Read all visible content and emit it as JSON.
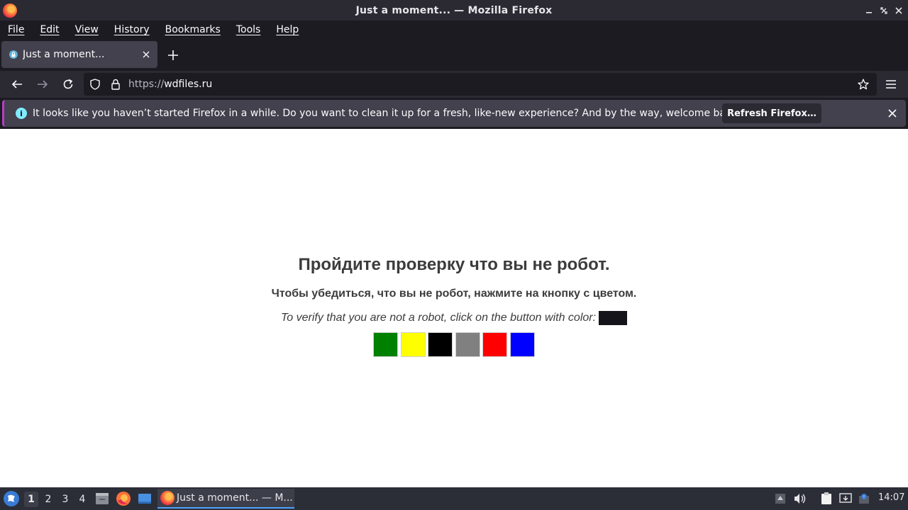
{
  "window": {
    "title": "Just a moment... — Mozilla Firefox",
    "controls": [
      "minimize-icon",
      "restore-icon",
      "close-icon"
    ]
  },
  "menubar": {
    "items": [
      {
        "label": "File"
      },
      {
        "label": "Edit"
      },
      {
        "label": "View"
      },
      {
        "label": "History"
      },
      {
        "label": "Bookmarks"
      },
      {
        "label": "Tools"
      },
      {
        "label": "Help"
      }
    ]
  },
  "tabs": [
    {
      "title": "Just a moment...",
      "active": true
    }
  ],
  "urlbar": {
    "scheme": "https://",
    "host": "wdfiles.ru"
  },
  "notification": {
    "text": "It looks like you haven’t started Firefox in a while. Do you want to clean it up for a fresh, like-new experience? And by the way, welcome back!",
    "button_label": "Refresh Firefox…"
  },
  "page": {
    "heading": "Пройдите проверку что вы не робот.",
    "subheading": "Чтобы убедиться, что вы не робот, нажмите на кнопку с цветом.",
    "instruction": "To verify that you are not a robot, click on the button with color:",
    "target_color": "#15141a",
    "color_buttons": [
      {
        "color": "#008000"
      },
      {
        "color": "#ffff00"
      },
      {
        "color": "#000000"
      },
      {
        "color": "#808080"
      },
      {
        "color": "#ff0000"
      },
      {
        "color": "#0000ff"
      }
    ]
  },
  "taskbar": {
    "workspaces": [
      "1",
      "2",
      "3",
      "4"
    ],
    "active_workspace": "1",
    "task_label": "Just a moment... — M...",
    "clock": "14:07"
  },
  "colors": {
    "chrome_dark": "#1c1b22",
    "toolbar": "#2b2a33",
    "tab_active": "#42414d",
    "notification_accent": "#b33fc7",
    "taskbar": "#2b2e37"
  }
}
